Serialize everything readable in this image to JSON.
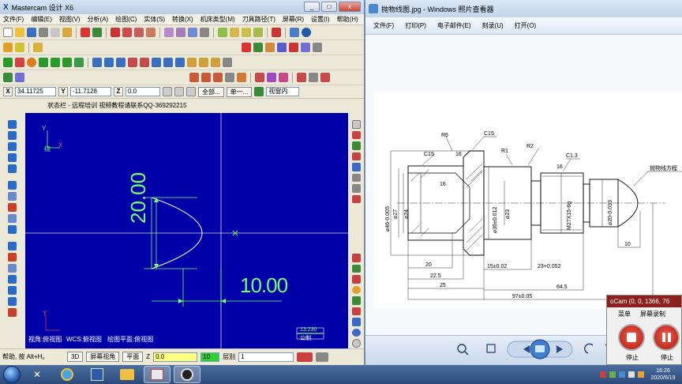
{
  "mastercam": {
    "title": "Mastercam 设计 X6",
    "logo": "X",
    "menu": [
      "文件(F)",
      "编辑(E)",
      "视图(V)",
      "分析(A)",
      "绘图(C)",
      "实体(S)",
      "转换(X)",
      "机床类型(M)",
      "刀具路径(T)",
      "屏幕(R)",
      "设置(I)",
      "帮助(H)"
    ],
    "coords": {
      "x_label": "X",
      "x_value": "34.11725",
      "y_label": "Y",
      "y_value": "-11.7128",
      "z_label": "Z",
      "z_value": "0.0"
    },
    "buttons": {
      "all": "全部...",
      "single": "单一...",
      "window_in": "视窗内"
    },
    "status_label": "状态栏 - 远程培训 视频教程请联系QQ-369292215",
    "viewport": {
      "axis_y": "Y",
      "axis_x": "X",
      "origin_label": "绕",
      "dim_vertical": "20.00",
      "dim_horizontal": "10.00",
      "bottom_texts": [
        "视角:俯视图",
        "WCS:俯视图",
        "绘图平面:俯视图"
      ],
      "scale_value": "13.230",
      "scale_unit": "公制",
      "corner_y": "Y"
    },
    "statusbar": {
      "help": "帮助, 按 Alt+H。",
      "mode_3d": "3D",
      "screen_view": "屏幕视角",
      "plane": "平面",
      "z_label": "Z",
      "z_value": "0.0",
      "level_value": "10",
      "layer_label": "层别",
      "layer_value": "1"
    },
    "window_buttons": [
      "_",
      "□",
      "x"
    ]
  },
  "photo_viewer": {
    "title": "抛物线图.jpg - Windows 照片查看器",
    "menu": [
      "文件(F)",
      "打印(P)",
      "电子邮件(E)",
      "刻录(U)",
      "打开(O)"
    ],
    "window_buttons": [
      "_",
      "□",
      "x"
    ]
  },
  "drawing": {
    "labels": {
      "r6": "R6",
      "r1": "R1",
      "r2": "R2",
      "c15a": "C15",
      "c15b": "C15",
      "c13": "C1.3",
      "n16a": "16",
      "n16b": "16",
      "n16c": "16",
      "d46": "⌀46-0.005",
      "d27": "⌀27",
      "d24": "⌀24",
      "d36": "⌀36±0.012",
      "d23": "⌀23",
      "m27": "M27X15-6g",
      "d20": "⌀20-0.033",
      "parabola_note": "抛物线方程",
      "l10": "10",
      "l20": "20",
      "l22_5": "22.5",
      "l25": "25",
      "l15": "15±0.02",
      "l23": "23+0.052",
      "l64_5": "64.5",
      "l97": "97±0.05"
    }
  },
  "ocam": {
    "title": "oCam (0, 0, 1366, 76",
    "menu": [
      "菜单",
      "屏幕录制"
    ],
    "stop_label": "停止",
    "pause_label": "停止"
  },
  "taskbar": {
    "time": "16:26",
    "date": "2020/6/19"
  }
}
